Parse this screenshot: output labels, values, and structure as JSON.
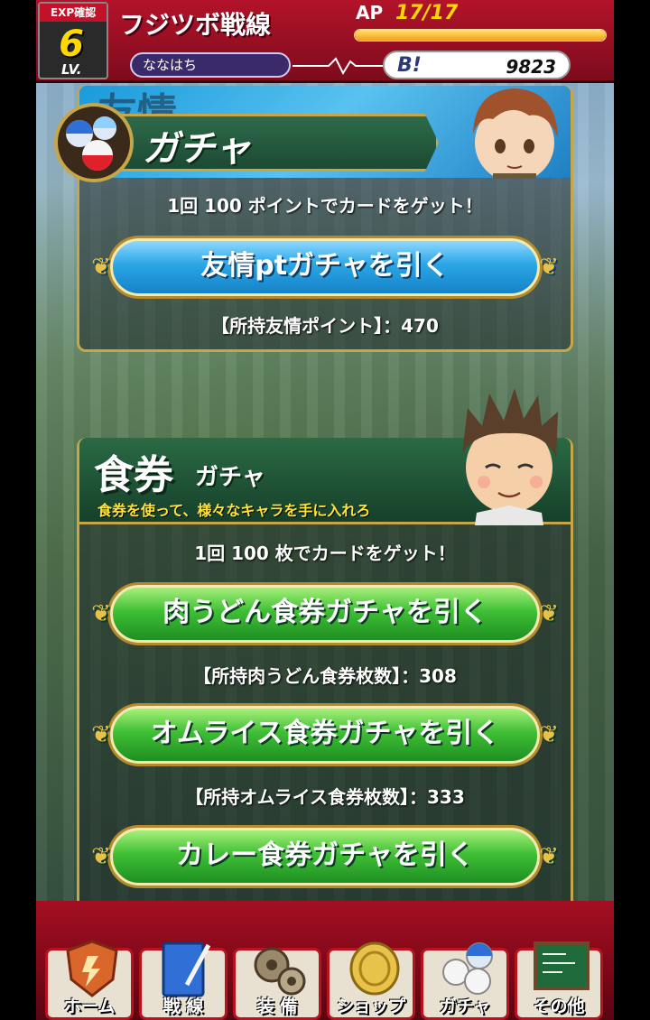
{
  "header": {
    "exp_label": "EXP確認",
    "level": "6",
    "level_label": "LV.",
    "title": "フジツボ戦線",
    "ap_label": "AP",
    "ap_value": "17/17",
    "ap_fraction": 1.0,
    "username": "ななはち",
    "b_label": "B!",
    "b_value": "9823"
  },
  "friend_gacha": {
    "banner_ghost": "友情",
    "tab_title": "ガチャ",
    "description": "1回 100 ポイントでカードをゲット！",
    "button": "友情ptガチャを引く",
    "count": "【所持友情ポイント】：470"
  },
  "food_gacha": {
    "title_big": "食券",
    "title_small": "ガチャ",
    "subtitle": "食券を使って、様々なキャラを手に入れろ",
    "description": "1回 100 枚でカードをゲット！",
    "items": [
      {
        "button": "肉うどん食券ガチャを引く",
        "count": "【所持肉うどん食券枚数】：308"
      },
      {
        "button": "オムライス食券ガチャを引く",
        "count": "【所持オムライス食券枚数】：333"
      },
      {
        "button": "カレー食券ガチャを引く"
      }
    ]
  },
  "nav": [
    {
      "label": "ホーム",
      "icon": "home-shield-icon"
    },
    {
      "label": "戦 線",
      "icon": "notebook-icon"
    },
    {
      "label": "装 備",
      "icon": "gears-icon"
    },
    {
      "label": "ショップ",
      "icon": "coin-icon"
    },
    {
      "label": "ガチャ",
      "icon": "capsule-icon"
    },
    {
      "label": "その他",
      "icon": "blackboard-icon"
    }
  ],
  "colors": {
    "header_red": "#b3132a",
    "gold_border": "#c6a64a",
    "blue_button": "#2aa6e6",
    "green_button": "#3fbf35",
    "level_yellow": "#ffd800"
  }
}
